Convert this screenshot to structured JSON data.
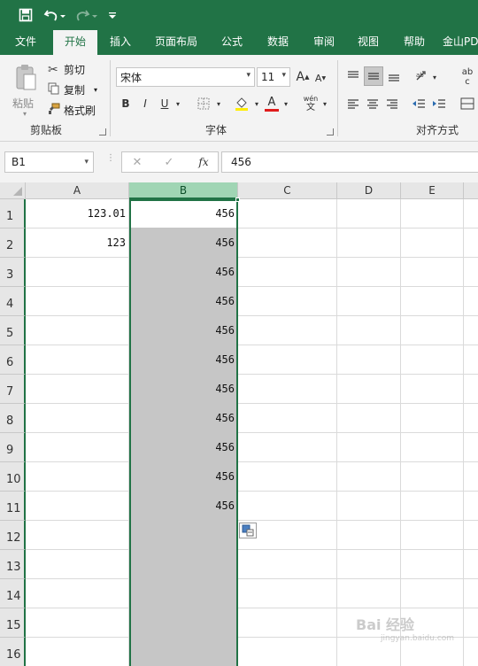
{
  "quick_access": {
    "save_icon": "save-icon",
    "undo_icon": "undo-icon",
    "redo_icon": "redo-icon",
    "customize_icon": "customize-qat-icon"
  },
  "tabs": [
    "文件",
    "开始",
    "插入",
    "页面布局",
    "公式",
    "数据",
    "审阅",
    "视图",
    "帮助",
    "金山PD"
  ],
  "active_tab": "开始",
  "ribbon": {
    "clipboard": {
      "paste_label": "粘贴",
      "cut_label": "剪切",
      "copy_label": "复制",
      "format_painter_label": "格式刷",
      "group_label": "剪贴板"
    },
    "font": {
      "font_name": "宋体",
      "font_size": "11",
      "grow_label": "A",
      "shrink_label": "A",
      "bold": "B",
      "italic": "I",
      "underline": "U",
      "font_color_label": "A",
      "phonetic_top": "wén",
      "phonetic_bottom": "文",
      "group_label": "字体"
    },
    "alignment": {
      "group_label": "对齐方式",
      "wrap_top": "ab",
      "wrap_bottom": "c"
    }
  },
  "formula_bar": {
    "name_box": "B1",
    "fx_label": "fx",
    "value": "456"
  },
  "grid": {
    "columns": [
      "A",
      "B",
      "C",
      "D",
      "E"
    ],
    "selected_column": "B",
    "rows": [
      {
        "num": "1",
        "A": "123.01",
        "B": "456"
      },
      {
        "num": "2",
        "A": "123",
        "B": "456"
      },
      {
        "num": "3",
        "A": "",
        "B": "456"
      },
      {
        "num": "4",
        "A": "",
        "B": "456"
      },
      {
        "num": "5",
        "A": "",
        "B": "456"
      },
      {
        "num": "6",
        "A": "",
        "B": "456"
      },
      {
        "num": "7",
        "A": "",
        "B": "456"
      },
      {
        "num": "8",
        "A": "",
        "B": "456"
      },
      {
        "num": "9",
        "A": "",
        "B": "456"
      },
      {
        "num": "10",
        "A": "",
        "B": "456"
      },
      {
        "num": "11",
        "A": "",
        "B": "456"
      },
      {
        "num": "12",
        "A": "",
        "B": ""
      },
      {
        "num": "13",
        "A": "",
        "B": ""
      },
      {
        "num": "14",
        "A": "",
        "B": ""
      },
      {
        "num": "15",
        "A": "",
        "B": ""
      },
      {
        "num": "16",
        "A": "",
        "B": ""
      }
    ]
  },
  "watermark": {
    "text": "Bai 经验",
    "sub": "jingyan.baidu.com"
  },
  "colors": {
    "excel_green": "#217346",
    "selection_fill": "#c6c6c6",
    "header_selected": "#a0d5b4"
  }
}
